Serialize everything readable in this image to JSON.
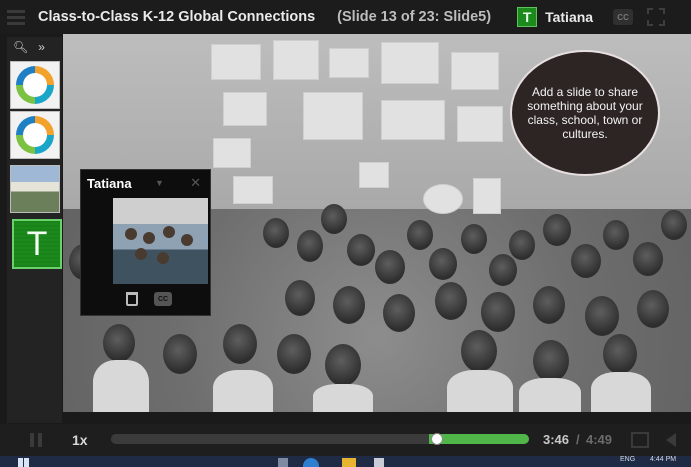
{
  "header": {
    "title": "Class-to-Class K-12 Global Connections",
    "slide_info": "(Slide 13 of 23: Slide5)",
    "user_initial": "T",
    "user_name": "Tatiana",
    "cc_label": "CC"
  },
  "sidebar": {
    "search_icon": "search-icon",
    "expand_label": "»",
    "thumbnails": [
      {
        "kind": "logo-ring"
      },
      {
        "kind": "logo-ring"
      },
      {
        "kind": "photo-building"
      },
      {
        "kind": "user-tile",
        "initial": "T"
      }
    ]
  },
  "slide": {
    "callout_text": "Add a slide to share something about your class, school, town or cultures."
  },
  "webcam": {
    "name": "Tatiana",
    "caret": "▼",
    "close": "✕",
    "cc_label": "CC"
  },
  "player": {
    "speed": "1x",
    "time_current": "3:46",
    "time_separator": "/",
    "time_total": "4:49",
    "progress_fraction": 0.78,
    "segment_start_fraction": 0.76,
    "segment_end_fraction": 1.0
  },
  "taskbar": {
    "lang": "ENG",
    "time": "4:44 PM"
  },
  "colors": {
    "accent_green": "#51b649",
    "user_tile_green": "#1b8a1b",
    "callout_bg": "#2d2424"
  }
}
